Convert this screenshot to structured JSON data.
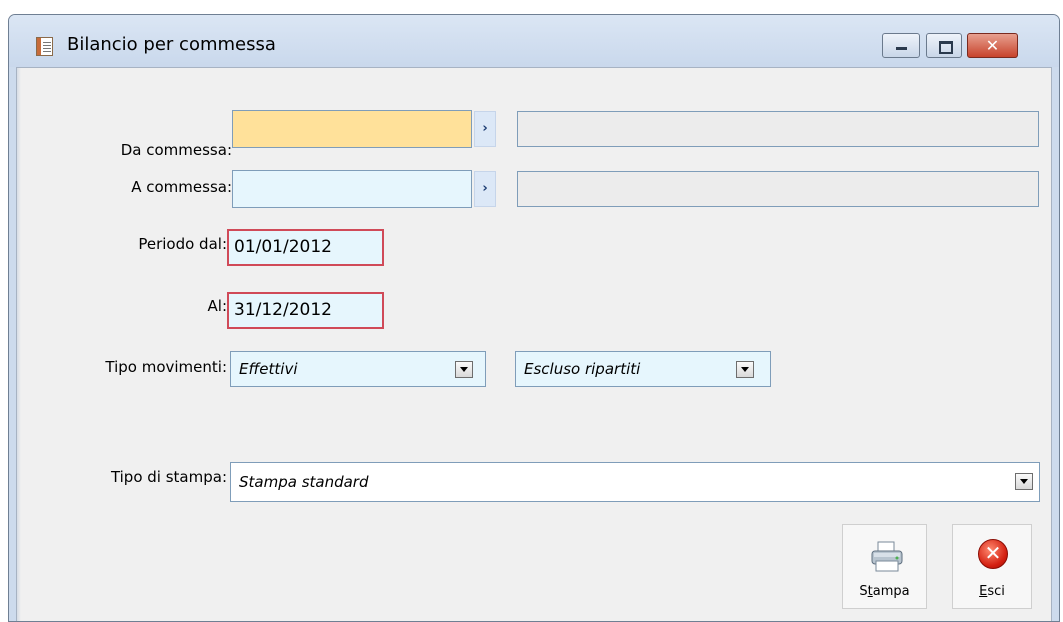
{
  "window": {
    "title": "Bilancio per commessa"
  },
  "form": {
    "da_commessa": {
      "label": "Da commessa:",
      "value": "",
      "description": "",
      "background": "#ffe19a"
    },
    "a_commessa": {
      "label": "A commessa:",
      "value": "",
      "description": "",
      "background": "#e6f6fd"
    },
    "periodo_dal": {
      "label": "Periodo dal:",
      "value": "01/01/2012"
    },
    "al": {
      "label": "Al:",
      "value": "31/12/2012"
    },
    "tipo_movimenti": {
      "label": "Tipo movimenti:",
      "selected": "Effettivi",
      "second_selected": "Escluso ripartiti"
    },
    "tipo_stampa": {
      "label": "Tipo di stampa:",
      "selected": "Stampa standard"
    }
  },
  "buttons": {
    "stampa": {
      "label_prefix": "S",
      "label_accel": "t",
      "label_rest": "ampa",
      "icon": "printer-icon"
    },
    "esci": {
      "label_accel": "E",
      "label_rest": "sci",
      "icon": "exit-icon"
    }
  },
  "colors": {
    "required_border": "#d04a58",
    "field_focus_bg": "#ffe19a",
    "field_bg": "#e6f6fd"
  }
}
